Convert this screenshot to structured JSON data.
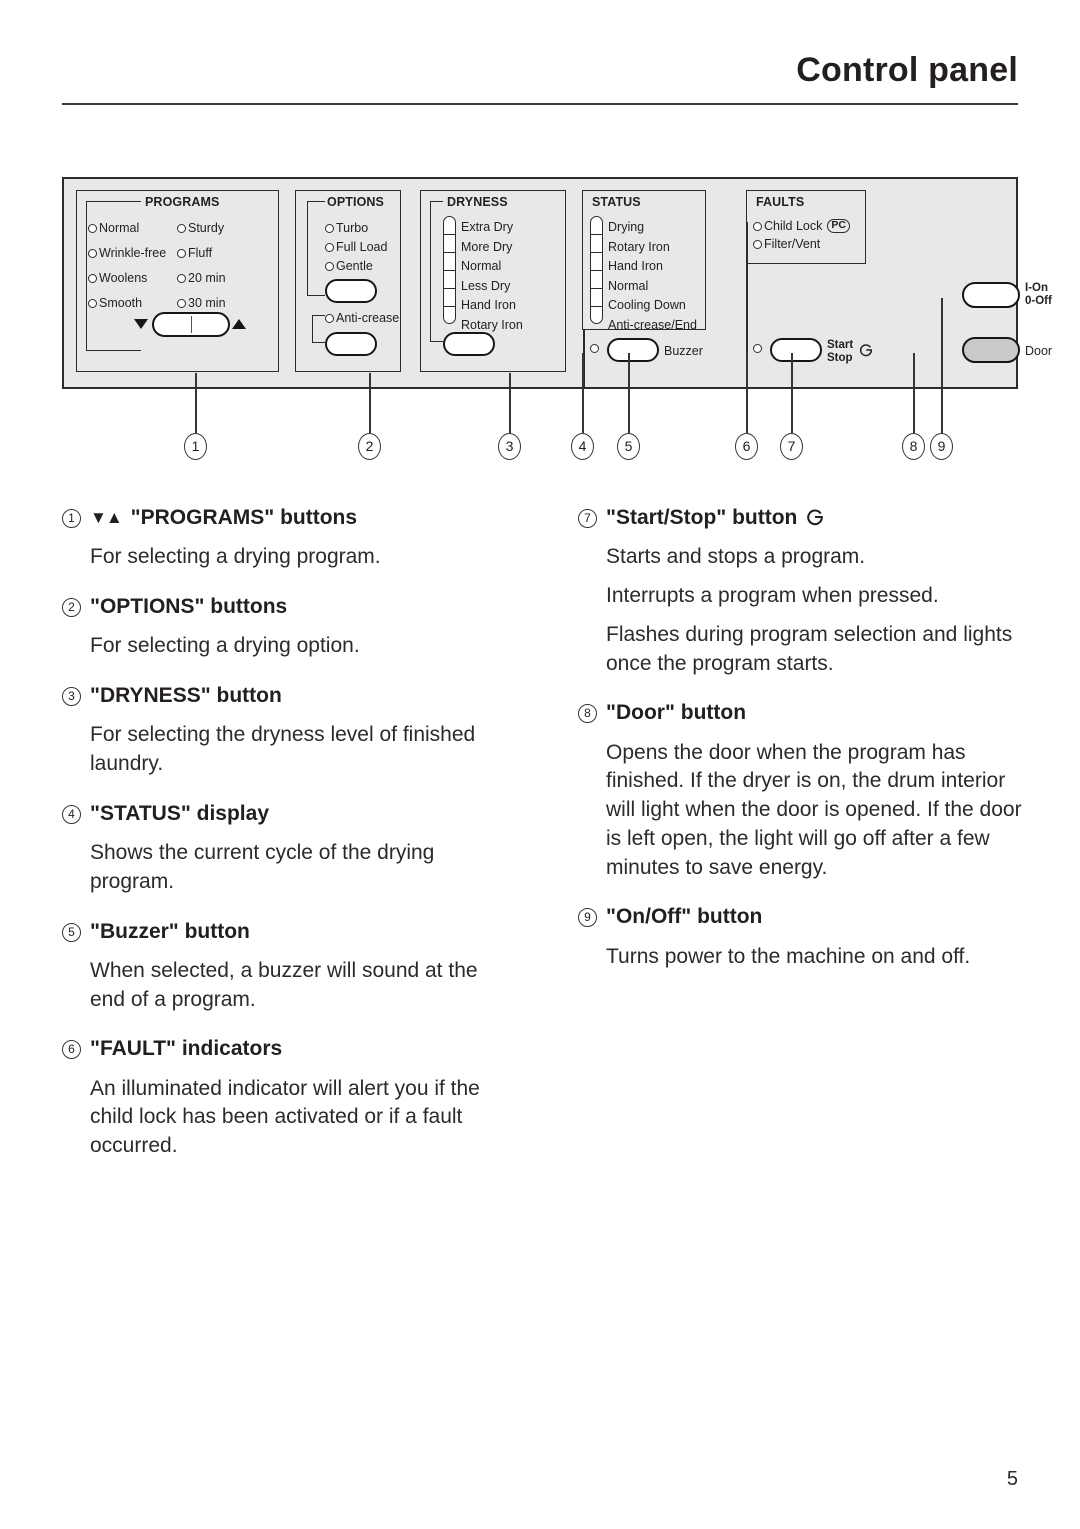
{
  "header": {
    "title": "Control panel"
  },
  "control_panel": {
    "groups": {
      "programs": {
        "title": "PROGRAMS",
        "options_left": [
          "Normal",
          "Wrinkle-free",
          "Woolens",
          "Smooth"
        ],
        "options_right": [
          "Sturdy",
          "Fluff",
          "20 min",
          "30 min"
        ],
        "down_arrow": "▼",
        "up_arrow": "▲"
      },
      "options": {
        "title": "OPTIONS",
        "items": [
          "Turbo",
          "Full Load",
          "Gentle"
        ],
        "secondary_item": "Anti-crease"
      },
      "dryness": {
        "title": "DRYNESS",
        "levels": [
          "Extra Dry",
          "More Dry",
          "Normal",
          "Less Dry",
          "Hand Iron",
          "Rotary Iron"
        ]
      },
      "status": {
        "title": "STATUS",
        "levels": [
          "Drying",
          "Rotary Iron",
          "Hand Iron",
          "Normal",
          "Cooling Down",
          "Anti-crease/End"
        ],
        "buzzer_label": "Buzzer"
      },
      "faults": {
        "title": "FAULTS",
        "items": [
          "Child Lock",
          "Filter/Vent"
        ],
        "child_lock_badge": "PC"
      }
    },
    "buttons": {
      "start_stop_line1": "Start",
      "start_stop_line2": "Stop",
      "start_stop_glyph": "⏻",
      "onoff_line1": "I-On",
      "onoff_line2": "0-Off",
      "door_label": "Door"
    },
    "callouts": [
      "1",
      "2",
      "3",
      "4",
      "5",
      "6",
      "7",
      "8",
      "9"
    ]
  },
  "legend": {
    "left": [
      {
        "num": "1",
        "arrows": "▼▲",
        "title": "\"PROGRAMS\" buttons",
        "paragraphs": [
          "For selecting a drying program."
        ]
      },
      {
        "num": "2",
        "title": "\"OPTIONS\" buttons",
        "paragraphs": [
          "For selecting a drying option."
        ]
      },
      {
        "num": "3",
        "title": "\"DRYNESS\" button",
        "paragraphs": [
          "For selecting the dryness level of finished laundry."
        ]
      },
      {
        "num": "4",
        "title": "\"STATUS\" display",
        "paragraphs": [
          "Shows the current cycle of the drying program."
        ]
      },
      {
        "num": "5",
        "title": "\"Buzzer\" button",
        "paragraphs": [
          "When selected, a buzzer will sound at the end of a program."
        ]
      },
      {
        "num": "6",
        "title": "\"FAULT\" indicators",
        "paragraphs": [
          "An illuminated indicator will alert you if the child lock has been activated or if a fault occurred."
        ]
      }
    ],
    "right": [
      {
        "num": "7",
        "title": "\"Start/Stop\" button",
        "glyph": "⏻",
        "paragraphs": [
          "Starts and stops a program.",
          "Interrupts a program when pressed.",
          "Flashes during program selection and lights once the program starts."
        ]
      },
      {
        "num": "8",
        "title": "\"Door\" button",
        "paragraphs": [
          "Opens the door when the program has finished. If the dryer is on, the drum interior will light when the door is opened. If the door is left open, the light will go off after a few minutes to save energy."
        ]
      },
      {
        "num": "9",
        "title": "\"On/Off\" button",
        "paragraphs": [
          "Turns power to the machine on and off."
        ]
      }
    ]
  },
  "footer": {
    "page_number": "5"
  }
}
